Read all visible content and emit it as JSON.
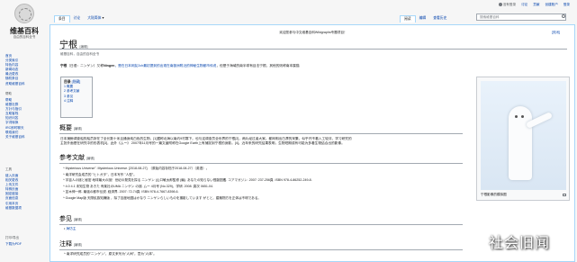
{
  "sidebar": {
    "logo_title": "维基百科",
    "logo_sub": "自由的百科全书",
    "sections": [
      {
        "head": "导航",
        "items": [
          "首页",
          "分类索引",
          "特色内容",
          "新闻动态",
          "最近更改",
          "随机条目",
          "资助维基百科"
        ]
      },
      {
        "head": "帮助",
        "items": [
          "帮助",
          "维基社群",
          "方针与指引",
          "互助客栈",
          "知识问答",
          "字词转换",
          "IRC即时聊天",
          "联络我们",
          "关于维基百科"
        ]
      },
      {
        "head": "工具",
        "items": [
          "链入页面",
          "相关更改",
          "上传文件",
          "特殊页面",
          "固定链接",
          "页面信息",
          "引用本页",
          "维基数据项"
        ]
      },
      {
        "head": "打印/导出",
        "items": [
          "下载为PDF"
        ]
      }
    ]
  },
  "personal": [
    "没有登录",
    "讨论",
    "贡献",
    "创建账户",
    "登录"
  ],
  "tabs_left": [
    "条目",
    "讨论",
    "大陆简体"
  ],
  "tabs_right": [
    "阅读",
    "编辑",
    "查看历史"
  ],
  "search": {
    "placeholder": "搜索维基百科"
  },
  "sitenotice": "欢迎您参与中文维基百科Wikigraphs专题项目！",
  "close_notice": "[关闭]",
  "article": {
    "title": "宁根",
    "edit": "[编辑]",
    "tagline": "维基百科，自由的百科全书",
    "lead_parts": [
      {
        "t": "宁根",
        "c": "bold"
      },
      {
        "t": "（日语：ニンゲン）又称",
        "c": ""
      },
      {
        "t": "Ningen",
        "c": "bold"
      },
      {
        "t": "，是在日本网友2ch最初提到的出现在南极洲附近的神秘生物都市传说",
        "c": ""
      },
      {
        "t": "，但是于海域的南半球有目击宁根，其他的则称南本属猫",
        "c": ""
      }
    ],
    "toc": {
      "title": "目录",
      "hide": "[隐藏]",
      "items": [
        "1 概要",
        "2 参考文献",
        "3 参见",
        "4 注释"
      ]
    },
    "sections": {
      "overview": "概要",
      "references": "参考文献",
      "see_also": "参见",
      "notes": "注释"
    },
    "overview_line1": "日本捕鲸调查船的船员所在了全长数十米且通身纯白色的生物，[1]据称北海以南约9村寒下。也与这调查员全世界的宁根[2]，两片经过者大家。都网明出白漂的采集，似乎开不看入工较评，学习研究的",
    "overview_line2": "主张外面是在研究中的形表机[3]，此外《ムー》 2007年11月号的一篇文章附称在Google Earth上有捕捉到宁根的身影。[4]。近年来的研究结果表明，生物短期成有可能为多看生物结合出的影像。",
    "refs": [
      "^ Mysterious Universe\". Mysterious Universe. [2018-08-27]. （原始内容存档于2018-08-27）（英语）。",
      "^ 南洋研究会成员的 \"ヒトガタ\"，日本写作 \"人型\"。",
      "^ 宇宙人の謎と秘密 地球最大の謎！世紀の発見を探る ニンゲン (山口敏太郎監修 (編). あなたの知らない怪獣図鑑. コアマガジン. 2007: 237-256頁. ISBN 978-4-86252-249-8.",
      "^ 4.0 4.1 未知生物 あきた 有楽社のUMA ニンゲン の謎. ムー 4月号 (No.329)，学研. 2008. 頁次 0651-04.",
      "^ 並木伸一郎. 最強の都市伝説. 経済界. 2007: 72-74頁. ISBN 978-4-7667-8398-6.",
      "^ Google Map版 天際民族知識版 ，除了百度地図はかなり ニンゲンらしいものを撮影しています がとと，建築物方を正体は不明である。"
    ],
    "see_also_item": "海坊主",
    "notes_item": "^ 南洋研究成员的\"ニンゲン\"，原文来写为\"人间\"，意为\"人体\"。"
  },
  "thumb_caption": "宁根影像的模拟图",
  "watermark": "社会旧闻"
}
